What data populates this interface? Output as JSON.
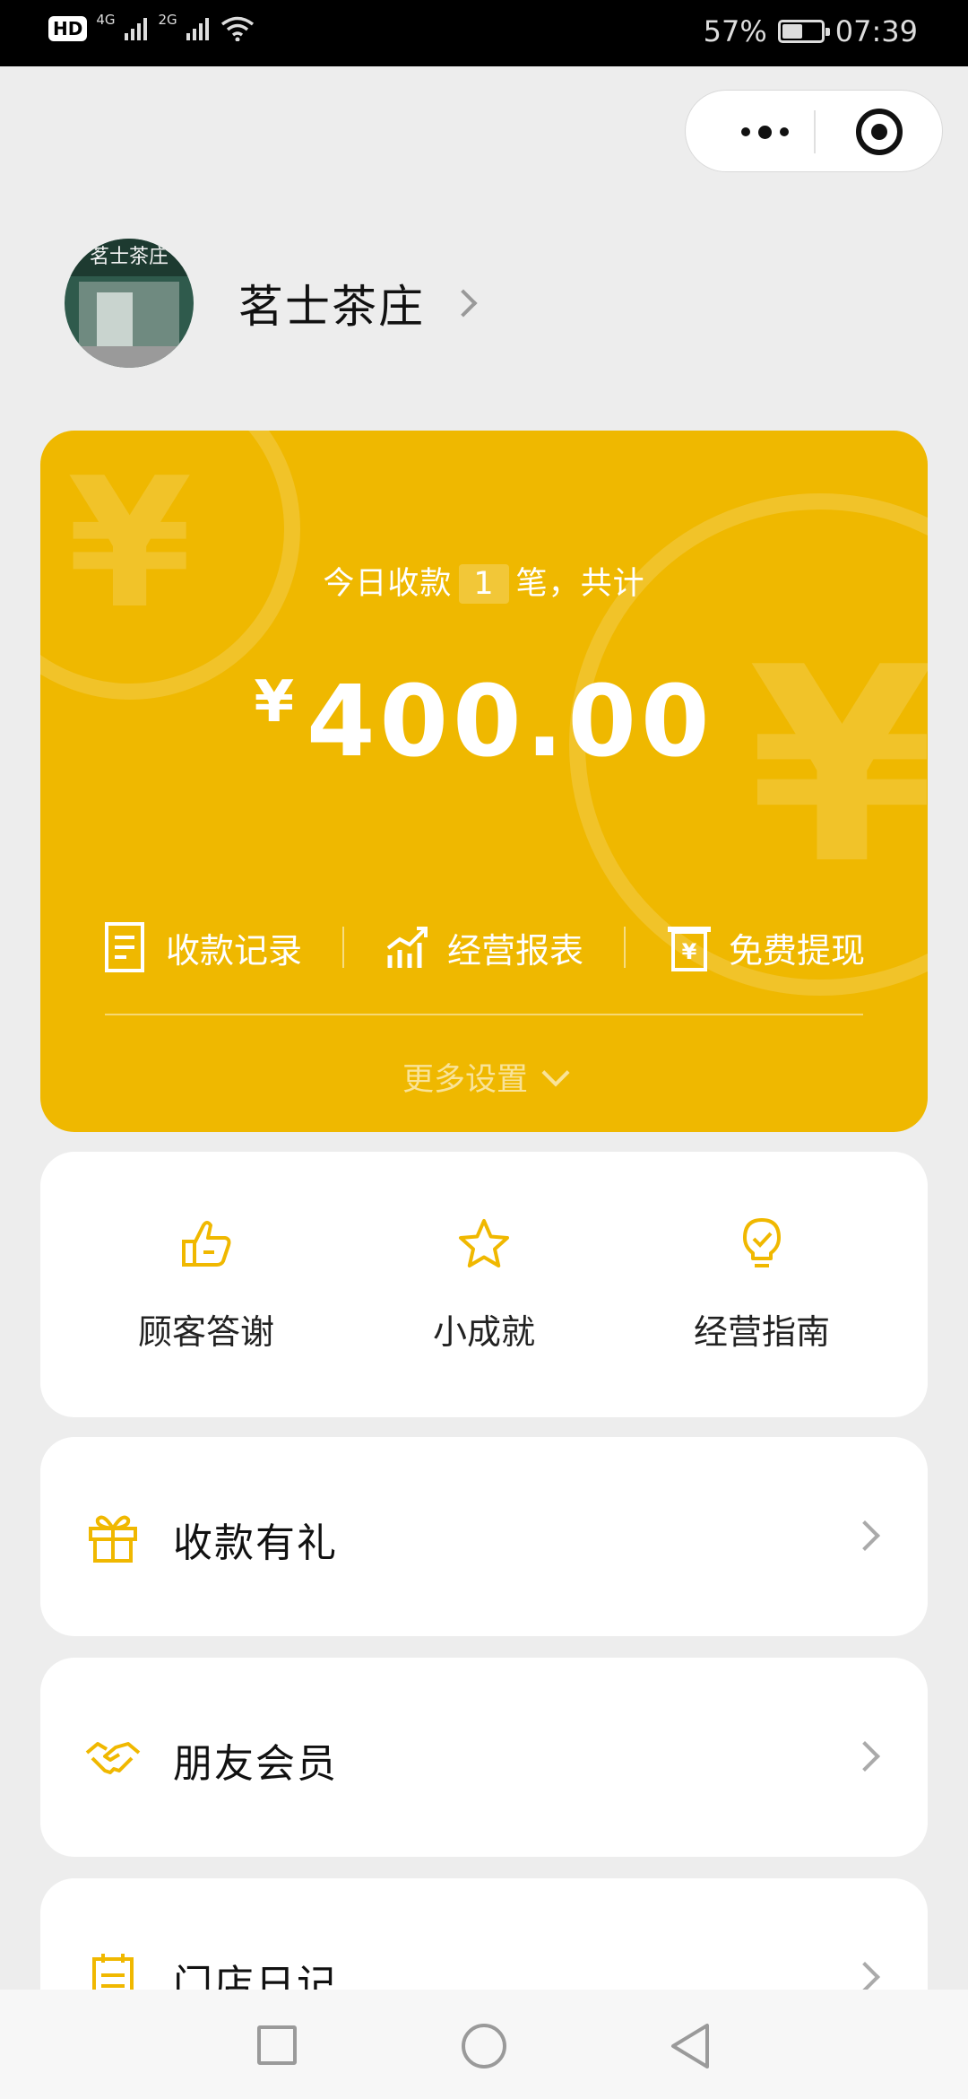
{
  "status_bar": {
    "hd": "HD",
    "sim1": "4G",
    "sim2": "2G",
    "battery_text": "57%",
    "battery_level": 0.57,
    "time": "07:39"
  },
  "store": {
    "name": "茗士茶庄",
    "avatar_sign": "茗士茶庄"
  },
  "card": {
    "summary_prefix": "今日收款",
    "count": "1",
    "summary_suffix": "笔，共计",
    "currency": "¥",
    "amount": "400.00",
    "actions": [
      {
        "label": "收款记录",
        "icon": "receipt-icon"
      },
      {
        "label": "经营报表",
        "icon": "chart-icon"
      },
      {
        "label": "免费提现",
        "icon": "withdraw-icon"
      }
    ],
    "more_settings": "更多设置",
    "color": "#efb800"
  },
  "tiles": [
    {
      "label": "顾客答谢",
      "icon": "thumbs-up-icon"
    },
    {
      "label": "小成就",
      "icon": "star-icon"
    },
    {
      "label": "经营指南",
      "icon": "lightbulb-icon"
    }
  ],
  "menu": [
    {
      "label": "收款有礼",
      "icon": "gift-icon"
    },
    {
      "label": "朋友会员",
      "icon": "handshake-icon"
    },
    {
      "label": "门店日记",
      "icon": "notepad-icon"
    }
  ],
  "accent_color": "#f0b800"
}
